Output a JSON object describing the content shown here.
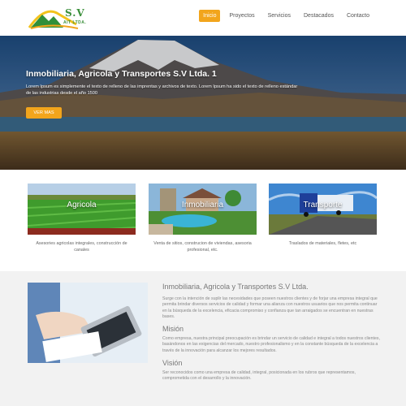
{
  "logo": {
    "brand": "S.V",
    "subtitle": "AIT LTDA."
  },
  "nav": {
    "items": [
      "Inicio",
      "Proyectos",
      "Servicios",
      "Destacados",
      "Contacto"
    ]
  },
  "hero": {
    "title": "Inmobiliaria, Agricola y Transportes S.V Ltda. 1",
    "text": "Lorem Ipsum es simplemente el texto de relleno de las imprentas y archivos de texto. Lorem Ipsum ha sido el texto de relleno estándar de las industrias desde el año 1500",
    "button": "VER MAS"
  },
  "services": [
    {
      "label": "Agricola",
      "desc": "Asesories agricolas integrales, construcción de canales"
    },
    {
      "label": "Inmobiliaria",
      "desc": "Venta de sitios, construcion de viviendas, asesoria profesional, etc."
    },
    {
      "label": "Transporte",
      "desc": "Traslados de materiales, fletes, etc"
    }
  ],
  "about": {
    "title": "Inmobiliaria, Agricola y Transportes S.V Ltda.",
    "intro": "Surge con la intención de suplir las necesidades que poseen nuestros clientes y de forjar una empresa integral que permita brindar diversos servicios de calidad y formar una alianza con nuestros usuarios que nos permita continuar en la búsqueda de la excelencia, eficacia compromiso y confianza que tan arraigados se encuentran en nuestras bases.",
    "mision_title": "Misión",
    "mision_text": "Como empresa, nuestra principal preocupación es brindar un servicio de calidad e integral a todos nuestros clientes, basándonos en las exigencias del mercado, nuestro profesionalismo y en la constante búsqueda de la excelencia a través de la innovación para alcanzar los mejores resultados.",
    "vision_title": "Visión",
    "vision_text": "Ser reconocidos como una empresa de calidad, integral, posicionada en los rubros que representamos, comprometida con el desarrollo y la innovación."
  }
}
